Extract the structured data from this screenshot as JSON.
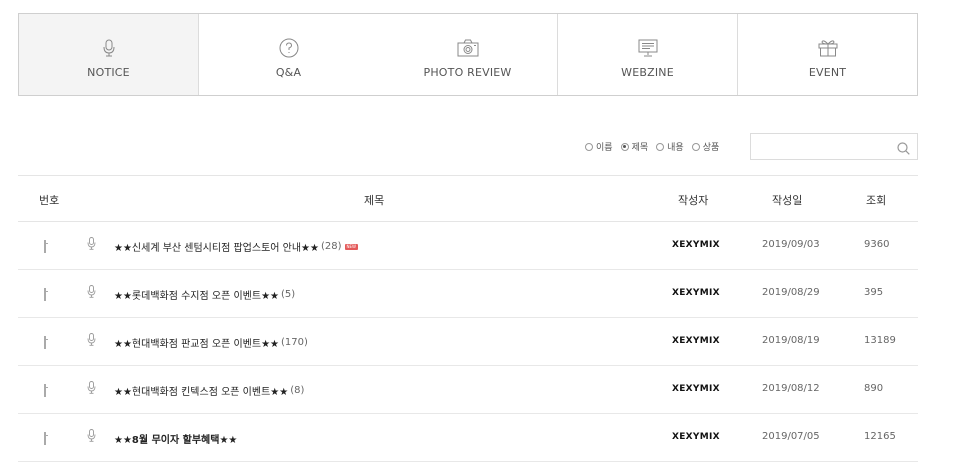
{
  "tabs": [
    {
      "label": "NOTICE",
      "icon": "microphone-icon"
    },
    {
      "label": "Q&A",
      "icon": "question-icon"
    },
    {
      "label": "PHOTO REVIEW",
      "icon": "camera-icon"
    },
    {
      "label": "WEBZINE",
      "icon": "monitor-icon"
    },
    {
      "label": "EVENT",
      "icon": "gift-icon"
    }
  ],
  "search": {
    "options": [
      {
        "label": "이름",
        "checked": false
      },
      {
        "label": "제목",
        "checked": true
      },
      {
        "label": "내용",
        "checked": false
      },
      {
        "label": "상품",
        "checked": false
      }
    ],
    "value": ""
  },
  "table": {
    "headers": {
      "num": "번호",
      "title": "제목",
      "author": "작성자",
      "date": "작성일",
      "views": "조회"
    },
    "rows": [
      {
        "title": "★★신세계 부산 센텀시티점 팝업스토어 안내★★",
        "count": "(28)",
        "new": "NEW",
        "author": "XEXYMIX",
        "date": "2019/09/03",
        "views": "9360"
      },
      {
        "title": "★★롯데백화점 수지점 오픈 이벤트★★",
        "count": "(5)",
        "new": "",
        "author": "XEXYMIX",
        "date": "2019/08/29",
        "views": "395"
      },
      {
        "title": "★★현대백화점 판교점 오픈 이벤트★★",
        "count": "(170)",
        "new": "",
        "author": "XEXYMIX",
        "date": "2019/08/19",
        "views": "13189"
      },
      {
        "title": "★★현대백화점 킨텍스점 오픈 이벤트★★",
        "count": "(8)",
        "new": "",
        "author": "XEXYMIX",
        "date": "2019/08/12",
        "views": "890"
      },
      {
        "title": "★★8월 무이자 할부혜택★★",
        "count": "",
        "new": "",
        "author": "XEXYMIX",
        "date": "2019/07/05",
        "views": "12165"
      }
    ]
  }
}
